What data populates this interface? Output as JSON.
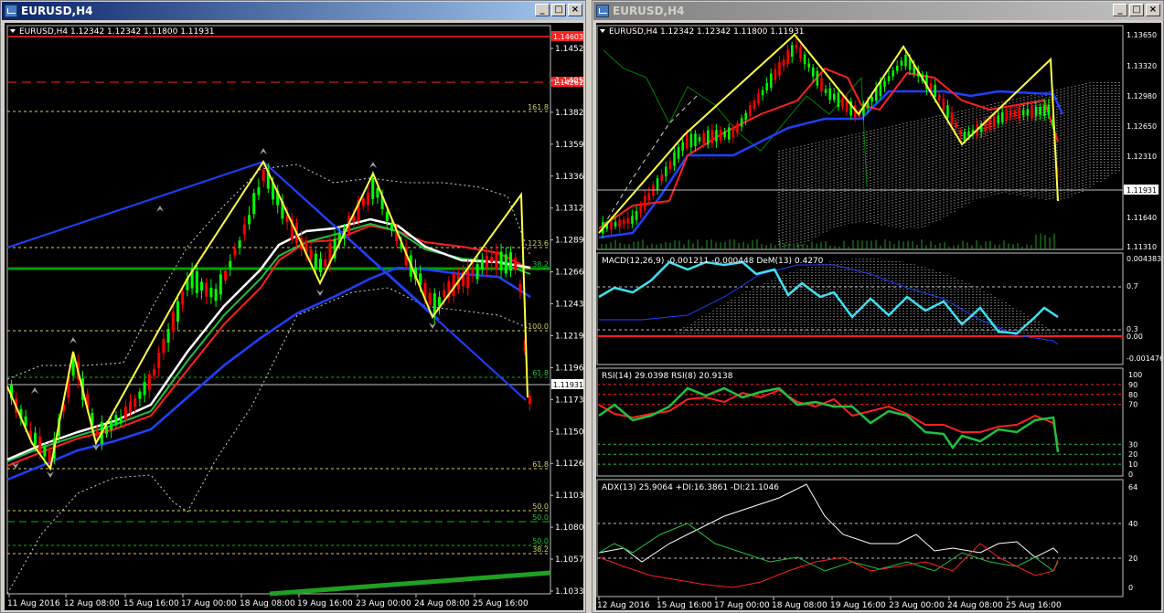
{
  "windows": [
    {
      "title": "EURUSD,H4",
      "buttons": [
        "_",
        "□",
        "×"
      ],
      "header": "EURUSD,H4  1.12342 1.12342 1.11800 1.11931",
      "price_labels": [
        "1.14520",
        "1.14055",
        "1.13820",
        "1.13590",
        "1.13360",
        "1.13125",
        "1.12895",
        "1.12660",
        "1.12430",
        "1.12195",
        "1.11965",
        "1.11730",
        "1.11500",
        "1.11265",
        "1.11035",
        "1.10800",
        "1.10570",
        "1.10335"
      ],
      "marker_labels": {
        "red_top": "1.14603",
        "red_dashed": "1.14261",
        "current": "1.11931"
      },
      "fib_labels": [
        "161.8",
        "123.6",
        "38.2",
        "100.0",
        "61.8",
        "61.8",
        "50.0",
        "50.0",
        "50.0",
        "38.2"
      ],
      "time_labels": [
        "11 Aug 2016",
        "12 Aug 08:00",
        "15 Aug 16:00",
        "17 Aug 00:00",
        "18 Aug 08:00",
        "19 Aug 16:00",
        "23 Aug 00:00",
        "24 Aug 08:00",
        "25 Aug 16:00"
      ]
    },
    {
      "title": "EURUSD,H4",
      "buttons": [
        "_",
        "□",
        "×"
      ],
      "header": "EURUSD,H4  1.12342 1.12342 1.11800 1.11931",
      "price_labels": [
        "1.13650",
        "1.13320",
        "1.12980",
        "1.12650",
        "1.12310",
        "1.11640",
        "1.11310"
      ],
      "current_label": "1.11931",
      "macd_header": "MACD(12,26,9) -0.001211 -0.000448  DeM(13) 0.4270",
      "macd_labels": [
        "0.004383",
        "0.7",
        "0.3",
        "0.00",
        "-0.001476"
      ],
      "rsi_header": "RSI(14) 29.0398  RSI(8) 20.9138",
      "rsi_labels": [
        "100",
        "90",
        "80",
        "70",
        "30",
        "20",
        "10",
        "0"
      ],
      "adx_header": "ADX(13) 25.9064  +DI:16.3861  -DI:21.1046",
      "adx_labels": [
        "64",
        "40",
        "20",
        "0"
      ],
      "time_labels": [
        "12 Aug 2016",
        "15 Aug 16:00",
        "17 Aug 00:00",
        "18 Aug 08:00",
        "19 Aug 16:00",
        "23 Aug 00:00",
        "24 Aug 08:00",
        "25 Aug 16:00"
      ]
    }
  ],
  "colors": {
    "bull": "#00ff00",
    "bear": "#ff0000",
    "zigzag": "#ffff40",
    "ma_blue": "#2040ff",
    "ma_white": "#ffffff",
    "ma_green": "#20c040",
    "ma_red": "#ff2020"
  }
}
